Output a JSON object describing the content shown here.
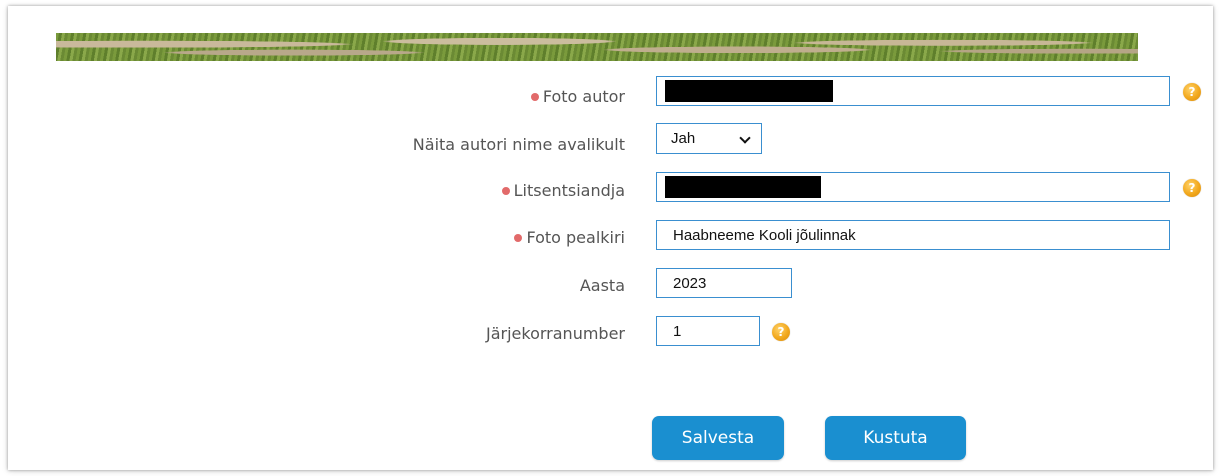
{
  "form": {
    "photo_author": {
      "label": "Foto autor",
      "required": true,
      "value": ""
    },
    "show_author": {
      "label": "Näita autori nime avalikult",
      "selected": "Jah"
    },
    "licensor": {
      "label": "Litsentsiandja",
      "required": true,
      "value": ""
    },
    "photo_title": {
      "label": "Foto pealkiri",
      "required": true,
      "value": "Haabneeme Kooli jõulinnak"
    },
    "year": {
      "label": "Aasta",
      "value": "2023"
    },
    "order_number": {
      "label": "Järjekorranumber",
      "value": "1"
    },
    "help_glyph": "?"
  },
  "actions": {
    "save_label": "Salvesta",
    "delete_label": "Kustuta"
  },
  "colors": {
    "input_border": "#3a8fd0",
    "button_bg": "#1a8fd0",
    "required_dot": "#e26a6a",
    "help_icon": "#f2a81d"
  }
}
